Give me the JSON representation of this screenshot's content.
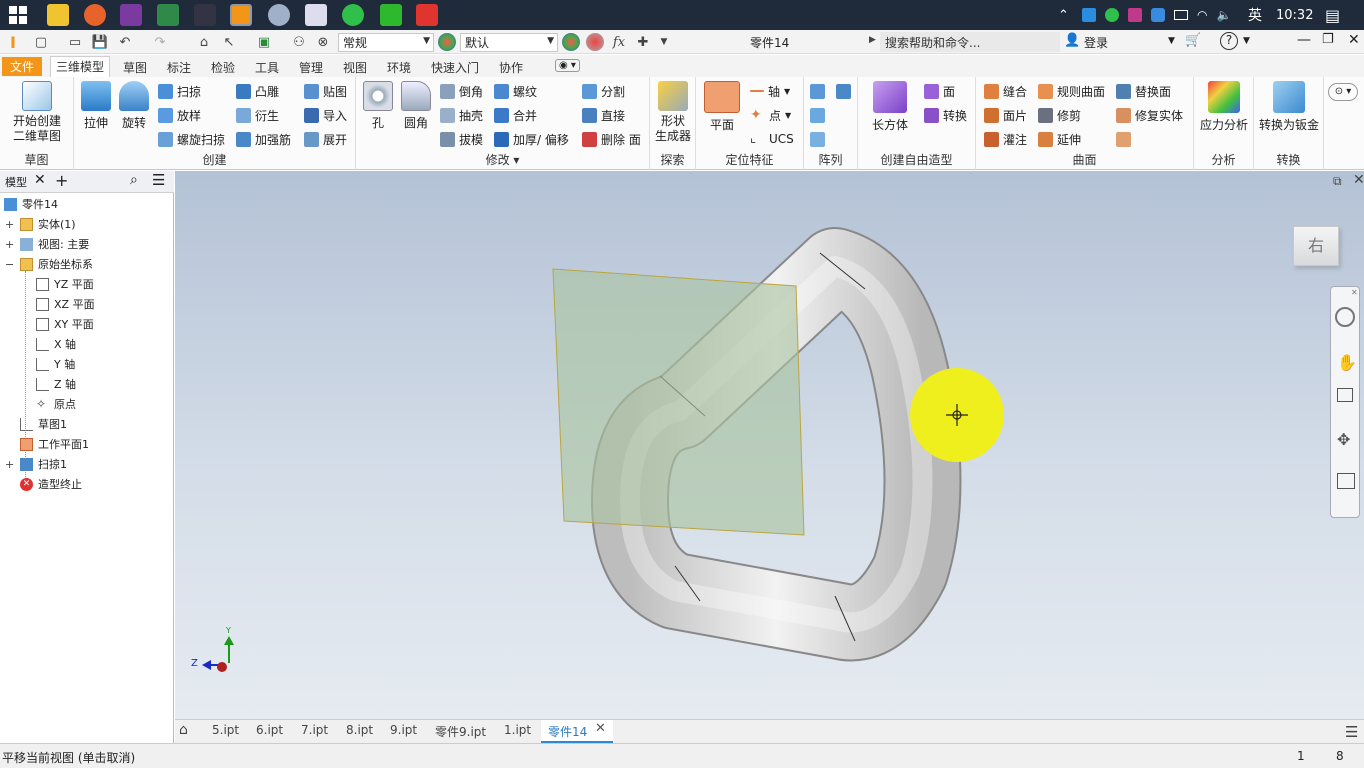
{
  "taskbar": {
    "time": "10:32",
    "ime": "英"
  },
  "qat": {
    "style_dropdown": "常规",
    "appearance_dropdown": "默认",
    "fx": "fx",
    "doc_title": "零件14",
    "search_placeholder": "搜索帮助和命令...",
    "login": "登录"
  },
  "tabs": [
    "文件",
    "三维模型",
    "草图",
    "标注",
    "检验",
    "工具",
    "管理",
    "视图",
    "环境",
    "快速入门",
    "协作"
  ],
  "ribbon": {
    "sketch_btn": "开始创建\n二维草图",
    "sketch_group": "草图",
    "create": {
      "extrude": "拉伸",
      "revolve": "旋转",
      "sweep": "扫掠",
      "loft": "放样",
      "coil": "螺旋扫掠",
      "emboss": "凸雕",
      "derive": "衍生",
      "rib": "加强筋",
      "decal": "贴图",
      "import": "导入",
      "unfold": "展开",
      "group": "创建"
    },
    "modify": {
      "hole": "孔",
      "fillet": "圆角",
      "chamfer": "倒角",
      "shell": "抽壳",
      "draft": "拔模",
      "thread": "螺纹",
      "combine": "合并",
      "thicken": "加厚/ 偏移",
      "split": "分割",
      "direct": "直接",
      "delete_face": "删除 面",
      "group": "修改 ▾"
    },
    "explore": {
      "shape_gen": "形状\n生成器",
      "group": "探索"
    },
    "work": {
      "plane": "平面",
      "axis": "轴",
      "point": "点",
      "ucs": "UCS",
      "group": "定位特征"
    },
    "pattern": {
      "group": "阵列"
    },
    "freeform": {
      "box": "长方体",
      "face": "面",
      "convert": "转换",
      "group": "创建自由造型"
    },
    "surface": {
      "stitch": "缝合",
      "patch": "面片",
      "sculpt": "灌注",
      "ruled": "规则曲面",
      "trim": "修剪",
      "extend": "延伸",
      "replace": "替换面",
      "repair": "修复实体",
      "group": "曲面"
    },
    "analysis": {
      "stress": "应力分析",
      "group": "分析"
    },
    "convert": {
      "sheetmetal": "转换为钣金",
      "group": "转换"
    }
  },
  "browser": {
    "tab": "模型",
    "tree": [
      {
        "label": "零件14"
      },
      {
        "label": "实体(1)"
      },
      {
        "label": "视图: 主要"
      },
      {
        "label": "原始坐标系"
      },
      {
        "label": "YZ 平面"
      },
      {
        "label": "XZ 平面"
      },
      {
        "label": "XY 平面"
      },
      {
        "label": "X 轴"
      },
      {
        "label": "Y 轴"
      },
      {
        "label": "Z 轴"
      },
      {
        "label": "原点"
      },
      {
        "label": "草图1"
      },
      {
        "label": "工作平面1"
      },
      {
        "label": "扫掠1"
      },
      {
        "label": "造型终止"
      }
    ]
  },
  "viewcube": {
    "face": "右"
  },
  "triad": {
    "y": "Y",
    "z": "Z"
  },
  "doctabs": [
    "5.ipt",
    "6.ipt",
    "7.ipt",
    "8.ipt",
    "9.ipt",
    "零件9.ipt",
    "1.ipt",
    "零件14"
  ],
  "status": {
    "text": "平移当前视图 (单击取消)",
    "n1": "1",
    "n2": "8"
  },
  "colors": {
    "file_tab": "#f29518",
    "workplane": "#a9c39f",
    "highlight": "#f0ef1e"
  }
}
